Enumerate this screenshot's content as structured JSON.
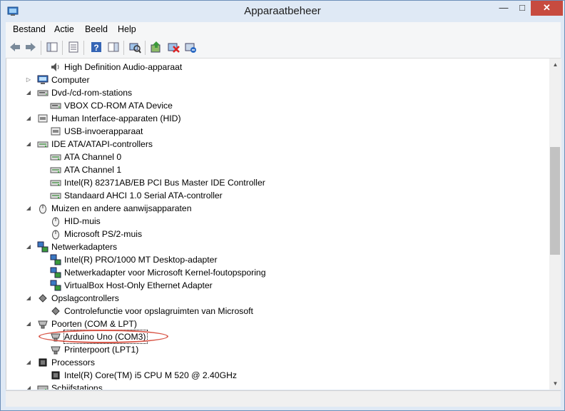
{
  "window": {
    "title": "Apparaatbeheer"
  },
  "menu": [
    "Bestand",
    "Actie",
    "Beeld",
    "Help"
  ],
  "toolbar": [
    "back-icon",
    "forward-icon",
    "show-hide-console-tree-icon",
    "properties-icon",
    "help-icon",
    "action-pane-icon",
    "scan-hardware-changes-icon",
    "update-driver-icon",
    "disable-device-icon",
    "uninstall-device-icon"
  ],
  "tree": [
    {
      "label": "High Definition Audio-apparaat",
      "level": 1,
      "expander": "",
      "icon": "speaker-icon"
    },
    {
      "label": "Computer",
      "level": 0,
      "expander": "▷",
      "icon": "computer-icon"
    },
    {
      "label": "Dvd-/cd-rom-stations",
      "level": 0,
      "expander": "◢",
      "icon": "dvd-drive-icon"
    },
    {
      "label": "VBOX CD-ROM ATA Device",
      "level": 1,
      "expander": "",
      "icon": "dvd-drive-icon"
    },
    {
      "label": "Human Interface-apparaten (HID)",
      "level": 0,
      "expander": "◢",
      "icon": "hid-icon"
    },
    {
      "label": "USB-invoerapparaat",
      "level": 1,
      "expander": "",
      "icon": "hid-icon"
    },
    {
      "label": "IDE ATA/ATAPI-controllers",
      "level": 0,
      "expander": "◢",
      "icon": "ide-controller-icon"
    },
    {
      "label": "ATA Channel 0",
      "level": 1,
      "expander": "",
      "icon": "ide-controller-icon"
    },
    {
      "label": "ATA Channel 1",
      "level": 1,
      "expander": "",
      "icon": "ide-controller-icon"
    },
    {
      "label": "Intel(R) 82371AB/EB PCI Bus Master IDE Controller",
      "level": 1,
      "expander": "",
      "icon": "ide-controller-icon"
    },
    {
      "label": "Standaard AHCI 1.0 Serial ATA-controller",
      "level": 1,
      "expander": "",
      "icon": "ide-controller-icon"
    },
    {
      "label": "Muizen en andere aanwijsapparaten",
      "level": 0,
      "expander": "◢",
      "icon": "mouse-icon"
    },
    {
      "label": "HID-muis",
      "level": 1,
      "expander": "",
      "icon": "mouse-icon"
    },
    {
      "label": "Microsoft PS/2-muis",
      "level": 1,
      "expander": "",
      "icon": "mouse-icon"
    },
    {
      "label": "Netwerkadapters",
      "level": 0,
      "expander": "◢",
      "icon": "network-adapter-icon"
    },
    {
      "label": "Intel(R) PRO/1000 MT Desktop-adapter",
      "level": 1,
      "expander": "",
      "icon": "network-adapter-icon"
    },
    {
      "label": "Netwerkadapter voor Microsoft Kernel-foutopsporing",
      "level": 1,
      "expander": "",
      "icon": "network-adapter-icon"
    },
    {
      "label": "VirtualBox Host-Only Ethernet Adapter",
      "level": 1,
      "expander": "",
      "icon": "network-adapter-icon"
    },
    {
      "label": "Opslagcontrollers",
      "level": 0,
      "expander": "◢",
      "icon": "storage-controller-icon"
    },
    {
      "label": "Controlefunctie voor opslagruimten van Microsoft",
      "level": 1,
      "expander": "",
      "icon": "storage-controller-icon"
    },
    {
      "label": "Poorten (COM & LPT)",
      "level": 0,
      "expander": "◢",
      "icon": "port-icon"
    },
    {
      "label": "Arduino Uno (COM3)",
      "level": 1,
      "expander": "",
      "icon": "port-icon",
      "selected": true
    },
    {
      "label": "Printerpoort (LPT1)",
      "level": 1,
      "expander": "",
      "icon": "port-icon"
    },
    {
      "label": "Processors",
      "level": 0,
      "expander": "◢",
      "icon": "processor-icon"
    },
    {
      "label": "Intel(R) Core(TM) i5 CPU       M 520  @ 2.40GHz",
      "level": 1,
      "expander": "",
      "icon": "processor-icon"
    },
    {
      "label": "Schijfstations",
      "level": 0,
      "expander": "◢",
      "icon": "disk-drive-icon"
    }
  ]
}
